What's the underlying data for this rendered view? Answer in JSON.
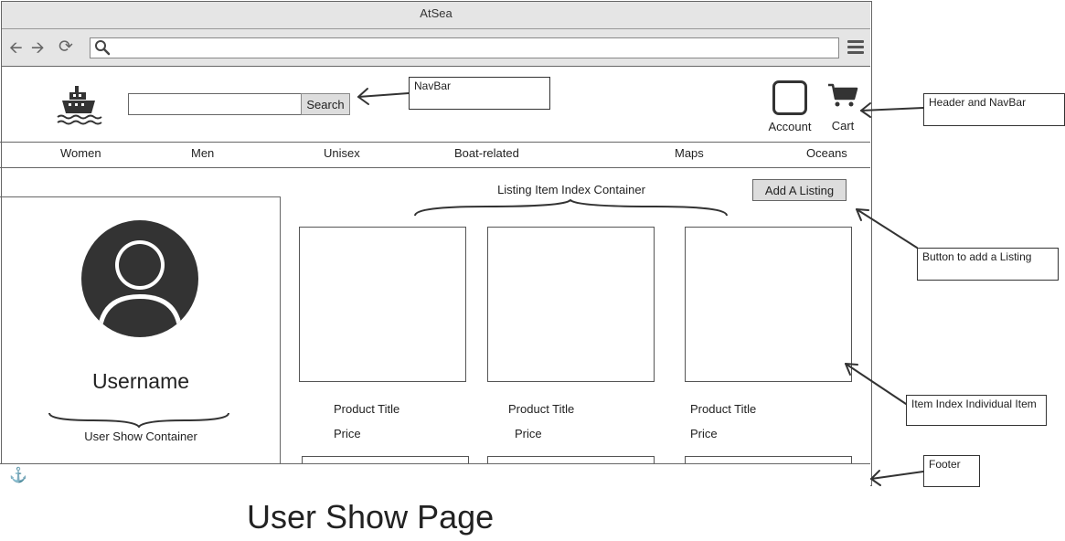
{
  "window": {
    "title": "AtSea"
  },
  "toolbar": {
    "address_value": ""
  },
  "header": {
    "search_placeholder": "",
    "search_button": "Search",
    "account_label": "Account",
    "cart_label": "Cart"
  },
  "nav": {
    "items": [
      "Women",
      "Men",
      "Unisex",
      "Boat-related",
      "Maps",
      "Oceans"
    ]
  },
  "profile": {
    "username": "Username",
    "container_label": "User Show Container"
  },
  "listing": {
    "container_label": "Listing Item Index Container",
    "add_button": "Add A Listing",
    "items": [
      {
        "title": "Product Title",
        "price": "Price"
      },
      {
        "title": "Product Title",
        "price": "Price"
      },
      {
        "title": "Product Title",
        "price": "Price"
      }
    ]
  },
  "annotations": {
    "navbar": "NavBar",
    "header_navbar": "Header and NavBar",
    "add_listing": "Button to add a Listing",
    "item_individual": "Item Index Individual Item",
    "footer": "Footer"
  },
  "caption": "User Show Page",
  "icons": {
    "back": "back-arrow-icon",
    "forward": "forward-arrow-icon",
    "reload": "reload-icon",
    "search": "search-icon",
    "menu": "hamburger-menu-icon",
    "logo": "ship-icon",
    "account": "account-icon",
    "cart": "cart-icon",
    "avatar": "user-avatar-icon",
    "footer": "anchor-icon"
  }
}
